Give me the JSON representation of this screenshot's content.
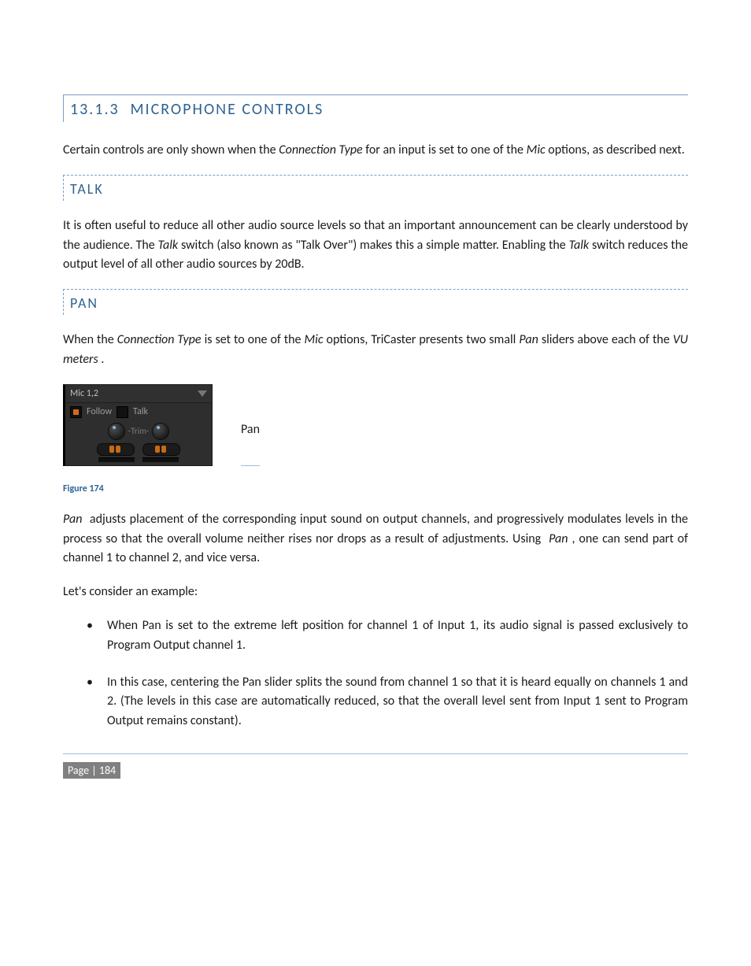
{
  "heading": {
    "number": "13.1.3",
    "title": "MICROPHONE CONTROLS"
  },
  "intro": {
    "plain1": "Certain controls are only shown when the ",
    "ital1": "Connection Type",
    "plain2": " for an input is set to one of the ",
    "ital2": "Mic",
    "plain3": " options, as described next."
  },
  "talk": {
    "title": "TALK",
    "para": {
      "p1": "It is often useful to reduce all other audio source levels so that an important announcement can be clearly understood by the audience. The ",
      "i1": "Talk",
      "p2": " switch (also known as \"Talk Over\") makes this a simple matter. Enabling the ",
      "i2": "Talk",
      "p3": " switch reduces the output level of all other audio sources by 20dB."
    }
  },
  "pan": {
    "title": "PAN",
    "intro": {
      "p1": "When the ",
      "i1": "Connection Type",
      "p2": " is set to one of the ",
      "i2": "Mic",
      "p3": " options, TriCaster presents two small ",
      "i3": "Pan",
      "p4": " sliders above each of the ",
      "i4": "VU meters",
      "p5": "."
    },
    "figure": {
      "panel_title": "Mic 1,2",
      "follow_label": "Follow",
      "talk_label": "Talk",
      "trim_label": "-Trim-",
      "side_label": "Pan",
      "caption": "Figure 174"
    },
    "explain": {
      "i1": "Pan",
      "p1": " adjusts placement of the corresponding input sound on output channels, and progressively modulates levels in the process so that the overall volume neither rises nor drops as a result of adjustments. Using ",
      "i2": "Pan",
      "p2": ", one can send part of channel 1 to channel 2, and vice versa."
    },
    "example_lead": "Let's consider an example:",
    "bullets": [
      {
        "p1": "When ",
        "i1": "Pan",
        "p2": " is set to the extreme left position for ",
        "i2": "channel 1 of Input 1,",
        "p3": " its audio signal is passed exclusively to ",
        "i3": "Program Output",
        "p4": " channel 1."
      },
      {
        "p1": "In this case, centering the ",
        "i1": "Pan",
        "p2": " slider splits the sound from channel 1 so that it is heard equally on channels 1 and 2.  (The levels in this case are automatically reduced, so that the overall level sent from ",
        "i2": "Input 1",
        "p3": " sent to ",
        "i3": "Program Output",
        "p4": " remains constant)."
      }
    ]
  },
  "footer": {
    "page_label": "Page | 184"
  }
}
